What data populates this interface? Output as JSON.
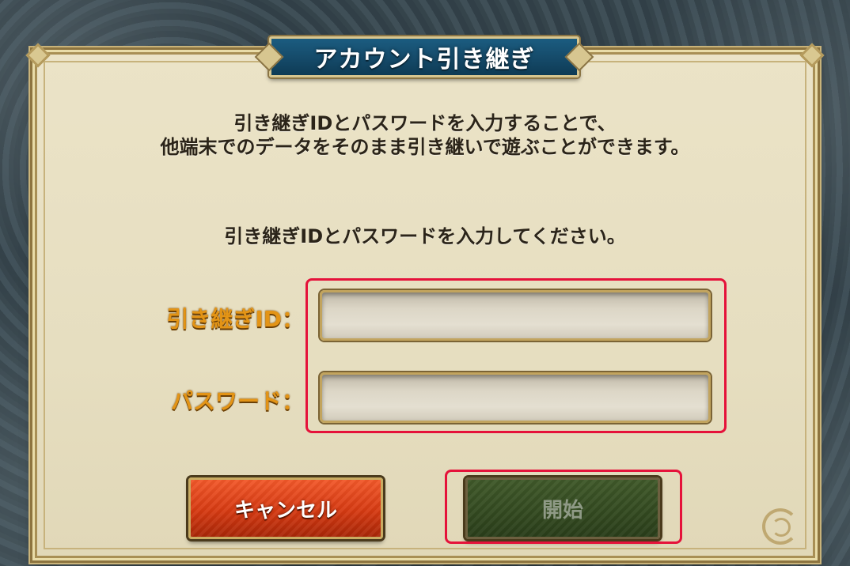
{
  "dialog": {
    "title": "アカウント引き継ぎ",
    "description_line1": "引き継ぎIDとパスワードを入力することで、",
    "description_line2": "他端末でのデータをそのまま引き継いで遊ぶことができます。",
    "prompt": "引き継ぎIDとパスワードを入力してください。"
  },
  "form": {
    "id_label": "引き継ぎID：",
    "id_value": "",
    "password_label": "パスワード：",
    "password_value": ""
  },
  "buttons": {
    "cancel_label": "キャンセル",
    "start_label": "開始"
  },
  "colors": {
    "highlight": "#e5123a",
    "title_banner": "#154a69",
    "label_orange": "#e39416",
    "cancel_red": "#d63a12",
    "start_green_disabled": "#344b21"
  }
}
